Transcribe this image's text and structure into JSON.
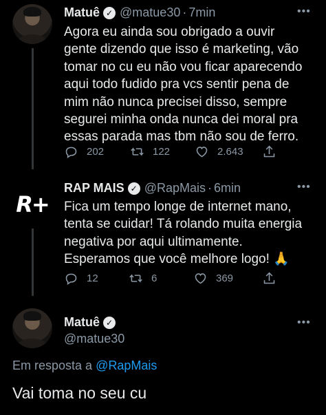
{
  "tweets": [
    {
      "name": "Matuê",
      "handle": "@matue30",
      "time": "7min",
      "text": [
        "Agora eu ainda sou obrigado a ouvir",
        "gente dizendo que isso é marketing, vão",
        "tomar no cu eu não vou ficar aparecendo",
        "aqui todo fudido pra vcs sentir pena de",
        "mim não nunca precisei disso, sempre",
        "segurei minha onda nunca dei moral pra",
        "essas parada mas tbm não sou de ferro."
      ],
      "replies": "202",
      "retweets": "122",
      "likes": "2.643"
    },
    {
      "name": "RAP MAIS",
      "handle": "@RapMais",
      "time": "6min",
      "logo": "R+",
      "text": [
        "Fica um tempo longe de internet mano,",
        "tenta se cuidar! Tá rolando muita energia",
        "negativa por aqui ultimamente.",
        "Esperamos que você melhore logo! 🙏"
      ],
      "replies": "12",
      "retweets": "6",
      "likes": "369"
    }
  ],
  "focused": {
    "name": "Matuê",
    "handle": "@matue30",
    "reply_prefix": "Em resposta a",
    "reply_to": "@RapMais",
    "text": "Vai toma no seu cu"
  },
  "more_label": "•••",
  "separator": "·",
  "icons": [
    "reply-icon",
    "retweet-icon",
    "like-icon",
    "share-icon",
    "verified-icon",
    "more-icon"
  ]
}
